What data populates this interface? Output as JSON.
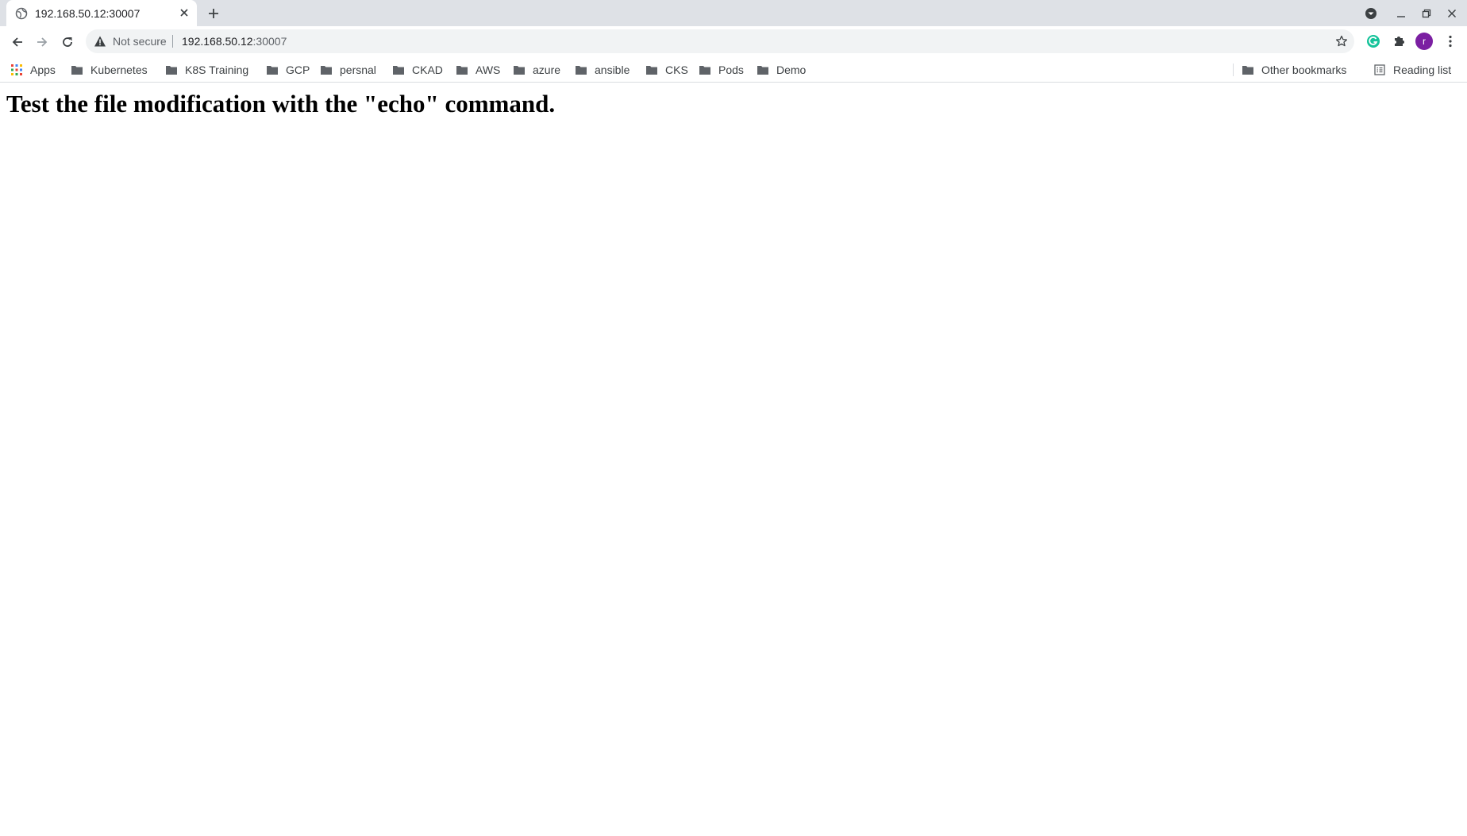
{
  "tab": {
    "title": "192.168.50.12:30007",
    "favicon": "globe-icon"
  },
  "toolbar": {
    "security_label": "Not secure",
    "url_host": "192.168.50.12",
    "url_port": ":30007",
    "profile_initial": "r",
    "profile_color": "#7b1fa2"
  },
  "bookmarks": {
    "items": [
      {
        "label": "Apps",
        "icon": "apps-grid-icon"
      },
      {
        "label": "Kubernetes",
        "icon": "folder-icon"
      },
      {
        "label": "K8S Training",
        "icon": "folder-icon"
      },
      {
        "label": "GCP",
        "icon": "folder-icon"
      },
      {
        "label": "persnal",
        "icon": "folder-icon"
      },
      {
        "label": "CKAD",
        "icon": "folder-icon"
      },
      {
        "label": "AWS",
        "icon": "folder-icon"
      },
      {
        "label": "azure",
        "icon": "folder-icon"
      },
      {
        "label": "ansible",
        "icon": "folder-icon"
      },
      {
        "label": "CKS",
        "icon": "folder-icon"
      },
      {
        "label": "Pods",
        "icon": "folder-icon"
      },
      {
        "label": "Demo",
        "icon": "folder-icon"
      }
    ],
    "other_label": "Other bookmarks",
    "reading_list_label": "Reading list"
  },
  "page": {
    "heading": "Test the file modification with the \"echo\" command."
  }
}
